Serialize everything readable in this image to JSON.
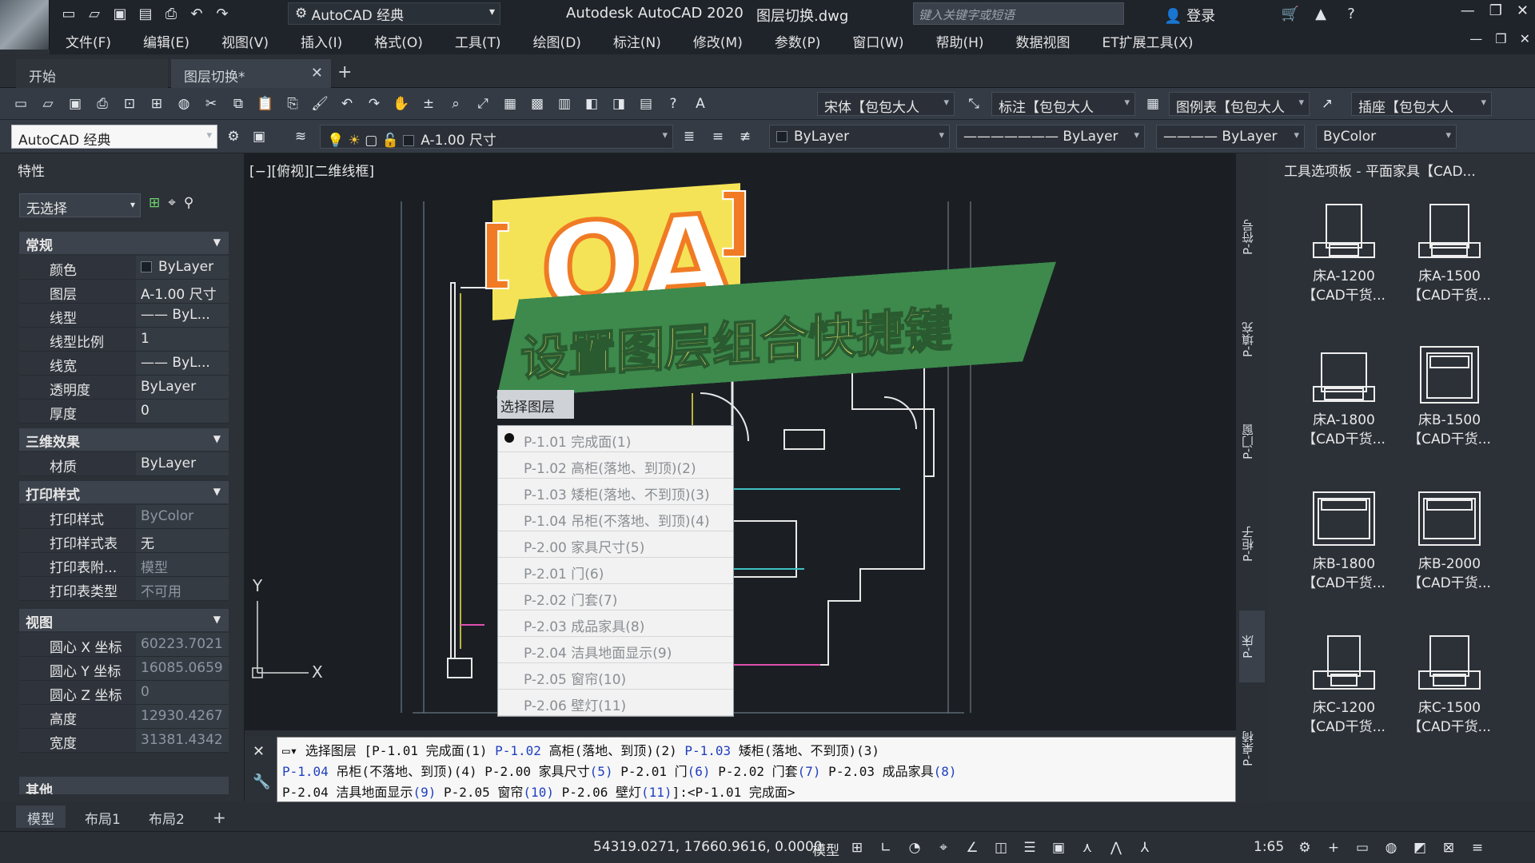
{
  "title_bar": {
    "workspace": "AutoCAD 经典",
    "app_title": "Autodesk AutoCAD 2020",
    "file_name": "图层切换.dwg",
    "search_placeholder": "键入关键字或短语",
    "login": "登录"
  },
  "menu": [
    "文件(F)",
    "编辑(E)",
    "视图(V)",
    "插入(I)",
    "格式(O)",
    "工具(T)",
    "绘图(D)",
    "标注(N)",
    "修改(M)",
    "参数(P)",
    "窗口(W)",
    "帮助(H)",
    "数据视图",
    "ET扩展工具(X)"
  ],
  "tabs": {
    "start": "开始",
    "active": "图层切换*"
  },
  "toolbar1": {
    "text_style": "宋体【包包大人",
    "dim_style": "标注【包包大人",
    "table_style": "图例表【包包大人",
    "mleader_style": "插座【包包大人"
  },
  "toolbar2": {
    "workspace": "AutoCAD 经典",
    "layer": "A-1.00 尺寸",
    "color": "ByLayer",
    "linetype": "ByLayer",
    "lineweight": "ByLayer",
    "plotstyle": "ByColor"
  },
  "properties": {
    "title": "特性",
    "selection": "无选择",
    "sections": {
      "general": "常规",
      "three_d": "三维效果",
      "plot": "打印样式",
      "view": "视图",
      "misc": "其他"
    },
    "general": [
      {
        "k": "颜色",
        "v": "ByLayer"
      },
      {
        "k": "图层",
        "v": "A-1.00 尺寸"
      },
      {
        "k": "线型",
        "v": "——  ByL..."
      },
      {
        "k": "线型比例",
        "v": "1"
      },
      {
        "k": "线宽",
        "v": "——  ByL..."
      },
      {
        "k": "透明度",
        "v": "ByLayer"
      },
      {
        "k": "厚度",
        "v": "0"
      }
    ],
    "three_d": [
      {
        "k": "材质",
        "v": "ByLayer"
      }
    ],
    "plot": [
      {
        "k": "打印样式",
        "v": "ByColor"
      },
      {
        "k": "打印样式表",
        "v": "无"
      },
      {
        "k": "打印表附...",
        "v": "模型"
      },
      {
        "k": "打印表类型",
        "v": "不可用"
      }
    ],
    "view": [
      {
        "k": "圆心 X 坐标",
        "v": "60223.7021"
      },
      {
        "k": "圆心 Y 坐标",
        "v": "16085.0659"
      },
      {
        "k": "圆心 Z 坐标",
        "v": "0"
      },
      {
        "k": "高度",
        "v": "12930.4267"
      },
      {
        "k": "宽度",
        "v": "31381.4342"
      }
    ]
  },
  "viewport": {
    "label": "[−][俯视][二维线框]",
    "axis_y": "Y",
    "axis_x": "X"
  },
  "banner": {
    "qa": "QA",
    "headline": "设置图层组合快捷键"
  },
  "layer_dropdown": {
    "title": "选择图层",
    "items": [
      "P-1.01 完成面(1)",
      "P-1.02 高柜(落地、到顶)(2)",
      "P-1.03 矮柜(落地、不到顶)(3)",
      "P-1.04 吊柜(不落地、到顶)(4)",
      "P-2.00 家具尺寸(5)",
      "P-2.01 门(6)",
      "P-2.02 门套(7)",
      "P-2.03 成品家具(8)",
      "P-2.04 洁具地面显示(9)",
      "P-2.05 窗帘(10)",
      "P-2.06 壁灯(11)"
    ]
  },
  "right_dock_tabs": [
    "P-符号",
    "P-填充",
    "P-门窗",
    "P-柜子",
    "P-床",
    "P-桌椅"
  ],
  "tool_palette": {
    "title": "工具选项板 - 平面家具【CAD...",
    "items": [
      {
        "name": "床A-1200",
        "sub": "【CAD干货..."
      },
      {
        "name": "床A-1500",
        "sub": "【CAD干货..."
      },
      {
        "name": "床A-1800",
        "sub": "【CAD干货..."
      },
      {
        "name": "床B-1500",
        "sub": "【CAD干货..."
      },
      {
        "name": "床B-1800",
        "sub": "【CAD干货..."
      },
      {
        "name": "床B-2000",
        "sub": "【CAD干货..."
      },
      {
        "name": "床C-1200",
        "sub": "【CAD干货..."
      },
      {
        "name": "床C-1500",
        "sub": "【CAD干货..."
      }
    ]
  },
  "command_line": {
    "line1_a": "选择图层 [P-1.01 完成面(1) ",
    "line1_b": "P-1.02",
    "line1_c": " 高柜(落地、到顶)(2) ",
    "line1_d": "P-1.03",
    "line1_e": " 矮柜(落地、不到顶)(3)",
    "line2_a": "P-1.04",
    "line2_b": " 吊柜(不落地、到顶)(4) P-2.00 家具尺寸",
    "line2_c": "(5)",
    "line2_d": " P-2.01 门",
    "line2_e": "(6)",
    "line2_f": " P-2.02 门套",
    "line2_g": "(7)",
    "line2_h": " P-2.03 成品家具",
    "line2_i": "(8)",
    "line3_a": "P-2.04 洁具地面显示",
    "line3_b": "(9)",
    "line3_c": " P-2.05 窗帘",
    "line3_d": "(10)",
    "line3_e": " P-2.06 壁灯",
    "line3_f": "(11)",
    "line3_g": "]:<P-1.01 完成面>"
  },
  "layout_tabs": [
    "模型",
    "布局1",
    "布局2"
  ],
  "status": {
    "coords": "54319.0271, 17660.9616, 0.0000",
    "model": "模型",
    "scale": "1:65"
  }
}
